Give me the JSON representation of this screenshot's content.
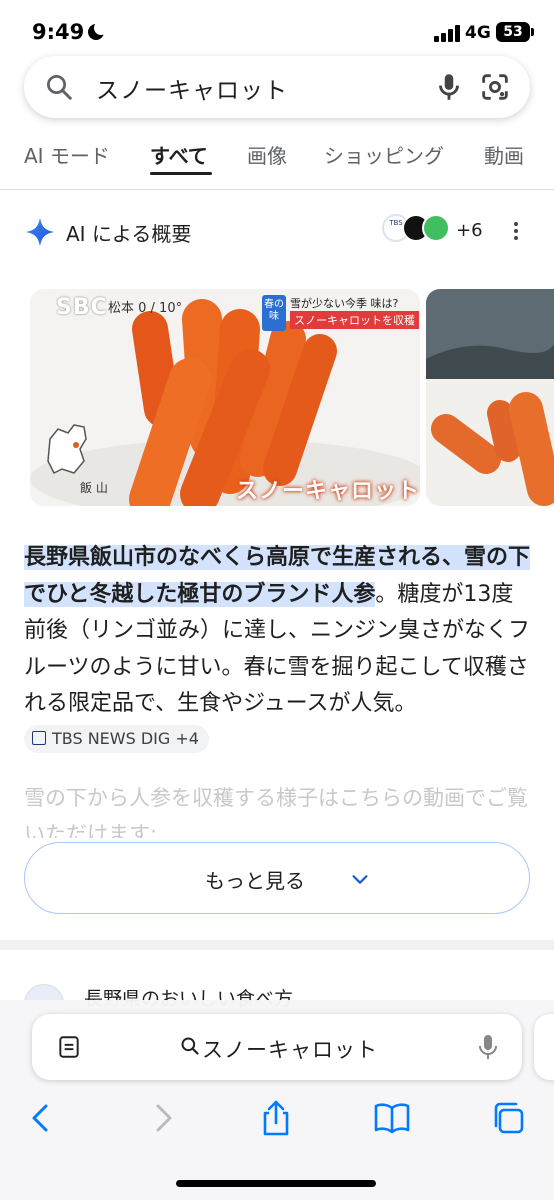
{
  "status_bar": {
    "time": "9:49",
    "network": "4G",
    "battery": "53"
  },
  "search": {
    "query": "スノーキャロット"
  },
  "tabs": [
    {
      "label": "AI モード"
    },
    {
      "label": "すべて",
      "active": true
    },
    {
      "label": "画像"
    },
    {
      "label": "ショッピング"
    },
    {
      "label": "動画"
    }
  ],
  "ai_overview": {
    "title": "AI による概要",
    "source_count": "+6",
    "image": {
      "channel_logo": "SBC",
      "weather": "松本 0 / 10°",
      "season_tag": "春の味",
      "headline_top": "雪が少ない今季 味は?",
      "headline_bottom": "スノーキャロットを収穫",
      "overlay_title": "スノーキャロット",
      "map_label": "飯 山"
    },
    "highlight": "長野県飯山市のなべくら高原で生産される、雪の下でひと冬越した極甘のブランド人参",
    "body": "。糖度が13度前後（リンゴ並み）に達し、ニンジン臭さがなくフルーツのように甘い。春に雪を掘り起こして収穫される限定品で、生食やジュースが人気。",
    "citation": "TBS NEWS DIG +4",
    "faded": "雪の下から人参を収穫する様子はこちらの動画でご覧いただけます:",
    "more_button": "もっと見る"
  },
  "next_result": {
    "title": "長野県のおいしい食べ方"
  },
  "browser": {
    "url_text": "スノーキャロット"
  },
  "colors": {
    "accent_blue": "#1a73e8",
    "highlight": "#d3e3fd",
    "ios_blue": "#007aff",
    "carrot": "#e8601c"
  }
}
